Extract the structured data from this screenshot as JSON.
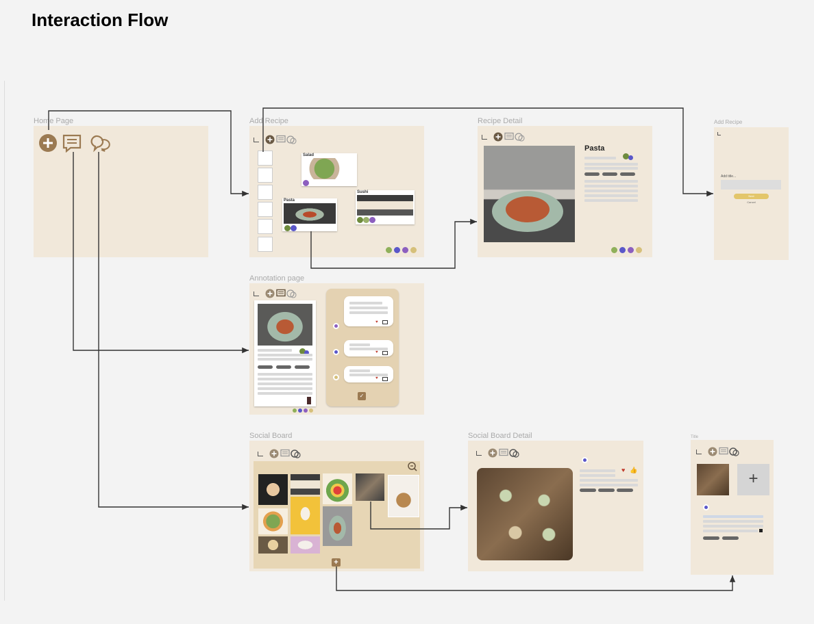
{
  "title": "Interaction Flow",
  "frames": {
    "home": "Home Page",
    "add_recipe": "Add Recipe",
    "recipe_detail": "Recipe Detail",
    "add_recipe_form": "Add Recipe",
    "annotation": "Annotation page",
    "social_board": "Social Board",
    "social_detail": "Social Board Detail",
    "social_new": "Title"
  },
  "add_recipe_cards": {
    "salad": "Salad",
    "pasta": "Pasta",
    "sushi": "Sushi"
  },
  "recipe_detail": {
    "dish_title": "Pasta"
  },
  "add_form": {
    "field_label": "Add title...",
    "button_label": "Next",
    "link_label": "Cancel"
  },
  "icons": [
    "add-icon",
    "annotation-icon",
    "chat-icon",
    "pin-icon",
    "zoom-icon",
    "plus-icon",
    "check-icon",
    "user-icon",
    "heart-icon",
    "like-icon"
  ],
  "colors": {
    "accent": "#9b7a52",
    "frame_bg": "#f1e8da",
    "canvas": "#f3f3f3",
    "connector": "#333333",
    "form_button": "#e3c66a"
  }
}
